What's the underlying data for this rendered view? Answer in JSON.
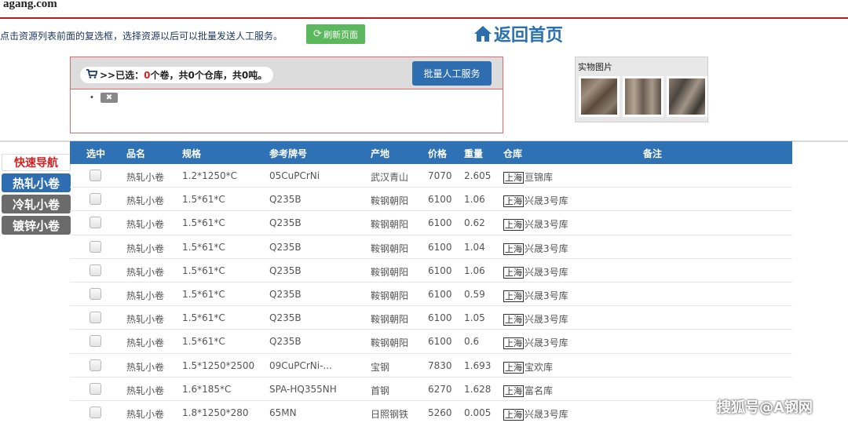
{
  "logo": "agang.com",
  "instruction": "点击资源列表前面的复选框，选择资源以后可以批量发送人工服务。",
  "refresh_label": "刷新页面",
  "home_label": "返回首页",
  "selection": {
    "prefix": ">>已选：",
    "rolls": "0",
    "rolls_unit": "个卷，共",
    "warehouses": "0",
    "warehouses_unit": "个仓库，共",
    "tons": "0",
    "tons_unit": "吨。"
  },
  "batch_button": "批量人工服务",
  "remove_label": "✖",
  "photos_title": "实物图片",
  "quicknav": {
    "title": "快速导航",
    "items": [
      "热轧小卷",
      "冷轧小卷",
      "镀锌小卷"
    ]
  },
  "table": {
    "headers": [
      "选中",
      "品名",
      "规格",
      "参考牌号",
      "产地",
      "价格",
      "重量",
      "仓库",
      "备注"
    ],
    "rows": [
      {
        "name": "热轧小卷",
        "spec": "1.2*1250*C",
        "grade": "05CuPCrNi",
        "origin": "武汉青山",
        "price": "7070",
        "weight": "2.605",
        "city": "上海",
        "warehouse": "亘锦库"
      },
      {
        "name": "热轧小卷",
        "spec": "1.5*61*C",
        "grade": "Q235B",
        "origin": "鞍钢朝阳",
        "price": "6100",
        "weight": "1.06",
        "city": "上海",
        "warehouse": "兴晟3号库"
      },
      {
        "name": "热轧小卷",
        "spec": "1.5*61*C",
        "grade": "Q235B",
        "origin": "鞍钢朝阳",
        "price": "6100",
        "weight": "0.62",
        "city": "上海",
        "warehouse": "兴晟3号库"
      },
      {
        "name": "热轧小卷",
        "spec": "1.5*61*C",
        "grade": "Q235B",
        "origin": "鞍钢朝阳",
        "price": "6100",
        "weight": "1.04",
        "city": "上海",
        "warehouse": "兴晟3号库"
      },
      {
        "name": "热轧小卷",
        "spec": "1.5*61*C",
        "grade": "Q235B",
        "origin": "鞍钢朝阳",
        "price": "6100",
        "weight": "1.06",
        "city": "上海",
        "warehouse": "兴晟3号库"
      },
      {
        "name": "热轧小卷",
        "spec": "1.5*61*C",
        "grade": "Q235B",
        "origin": "鞍钢朝阳",
        "price": "6100",
        "weight": "0.59",
        "city": "上海",
        "warehouse": "兴晟3号库"
      },
      {
        "name": "热轧小卷",
        "spec": "1.5*61*C",
        "grade": "Q235B",
        "origin": "鞍钢朝阳",
        "price": "6100",
        "weight": "1.05",
        "city": "上海",
        "warehouse": "兴晟3号库"
      },
      {
        "name": "热轧小卷",
        "spec": "1.5*61*C",
        "grade": "Q235B",
        "origin": "鞍钢朝阳",
        "price": "6100",
        "weight": "0.6",
        "city": "上海",
        "warehouse": "兴晟3号库"
      },
      {
        "name": "热轧小卷",
        "spec": "1.5*1250*2500",
        "grade": "09CuPCrNi-...",
        "origin": "宝钢",
        "price": "7830",
        "weight": "1.693",
        "city": "上海",
        "warehouse": "宝欢库"
      },
      {
        "name": "热轧小卷",
        "spec": "1.6*185*C",
        "grade": "SPA-HQ355NH",
        "origin": "首钢",
        "price": "6270",
        "weight": "1.628",
        "city": "上海",
        "warehouse": "富名库"
      },
      {
        "name": "热轧小卷",
        "spec": "1.8*1250*280",
        "grade": "65MN",
        "origin": "日照钢铁",
        "price": "5260",
        "weight": "0.005",
        "city": "上海",
        "warehouse": "兴晟3号库"
      }
    ]
  },
  "watermark": "搜狐号@A钢网"
}
